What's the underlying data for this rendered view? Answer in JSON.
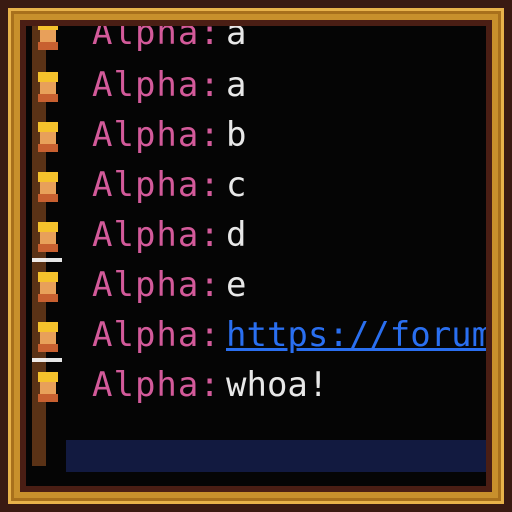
{
  "chat": {
    "messages": [
      {
        "name": "Alpha:",
        "text": "a",
        "is_link": false
      },
      {
        "name": "Alpha:",
        "text": "a",
        "is_link": false
      },
      {
        "name": "Alpha:",
        "text": "b",
        "is_link": false
      },
      {
        "name": "Alpha:",
        "text": "c",
        "is_link": false
      },
      {
        "name": "Alpha:",
        "text": "d",
        "is_link": false
      },
      {
        "name": "Alpha:",
        "text": "e",
        "is_link": false
      },
      {
        "name": "Alpha:",
        "text": "https://forum",
        "is_link": true
      },
      {
        "name": "Alpha:",
        "text": "whoa!",
        "is_link": false
      }
    ]
  },
  "colors": {
    "name": "#d35a9a",
    "message": "#e8e8e8",
    "link": "#2a6ff0",
    "frame_gold": "#c8902c",
    "panel": "#050505",
    "input": "#121a40"
  }
}
